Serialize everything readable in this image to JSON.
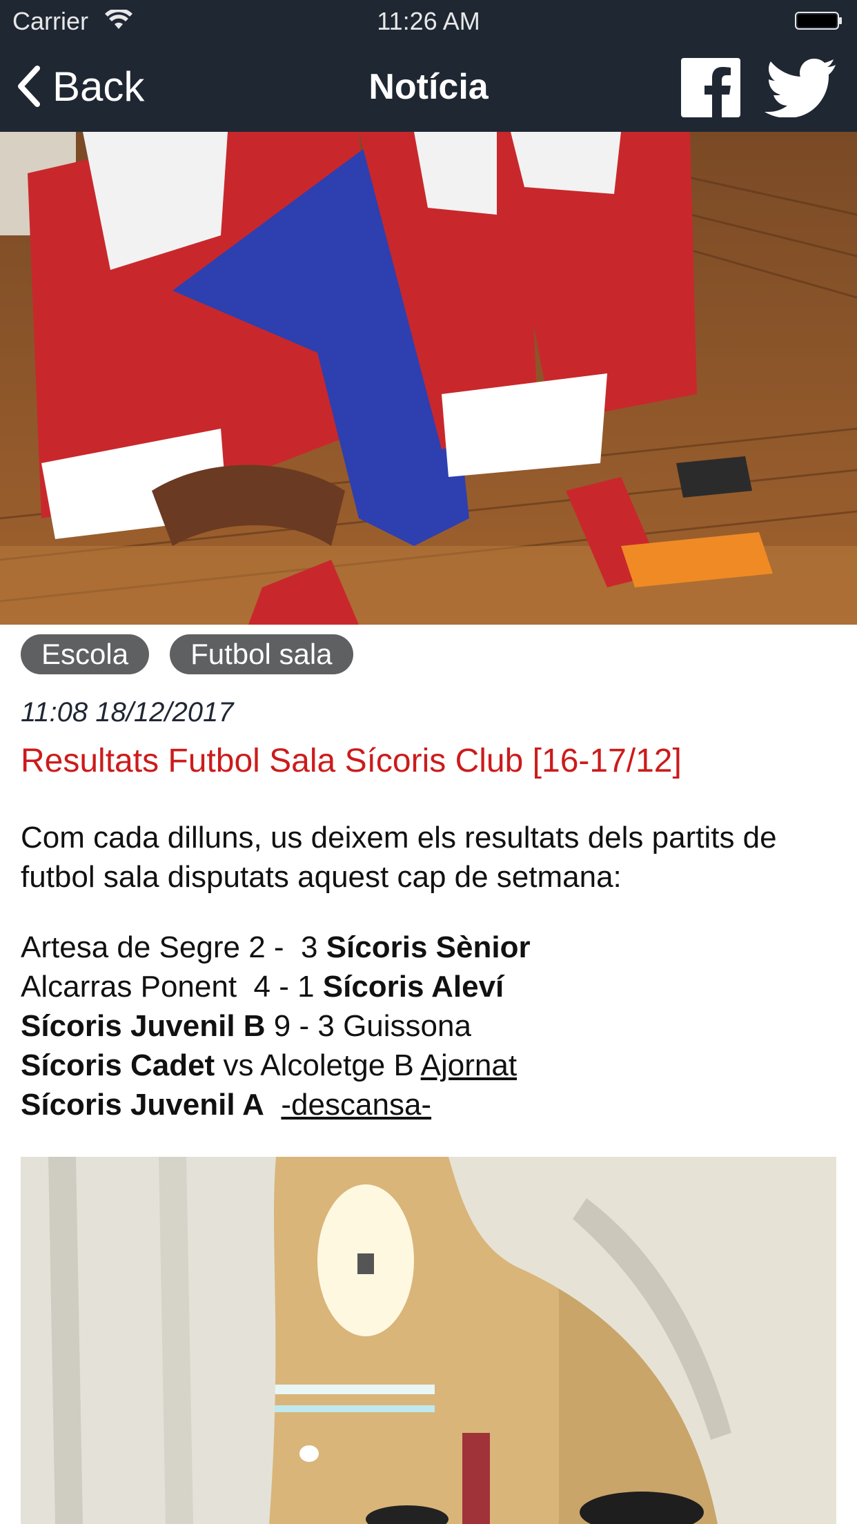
{
  "status_bar": {
    "carrier": "Carrier",
    "time": "11:26 AM"
  },
  "nav": {
    "back_label": "Back",
    "title": "Notícia"
  },
  "colors": {
    "nav_bg": "#1f2733",
    "headline": "#cc1b1b",
    "tag_bg": "#5f6062"
  },
  "icons": {
    "facebook": "facebook-icon",
    "twitter": "twitter-icon",
    "back": "chevron-left-icon"
  },
  "tags": [
    {
      "label": "Escola"
    },
    {
      "label": "Futbol sala"
    }
  ],
  "article": {
    "date": "11:08 18/12/2017",
    "headline": "Resultats Futbol Sala Sícoris Club [16-17/12]",
    "intro": "Com cada dilluns, us deixem els resultats dels partits de futbol sala disputats aquest cap de setmana:",
    "results": [
      {
        "a": "Artesa de Segre 2 -  3 ",
        "b": "Sícoris Sènior"
      },
      {
        "a": "Alcarras Ponent  4 - 1 ",
        "b": "Sícoris Aleví"
      },
      {
        "b": "Sícoris Juvenil B",
        "a": " 9 - 3 Guissona"
      },
      {
        "b": "Sícoris Cadet",
        "a": " vs Alcoletge B ",
        "link": "Ajornat"
      },
      {
        "b": "Sícoris Juvenil A",
        "a": "  ",
        "link": "-descansa-"
      }
    ]
  }
}
